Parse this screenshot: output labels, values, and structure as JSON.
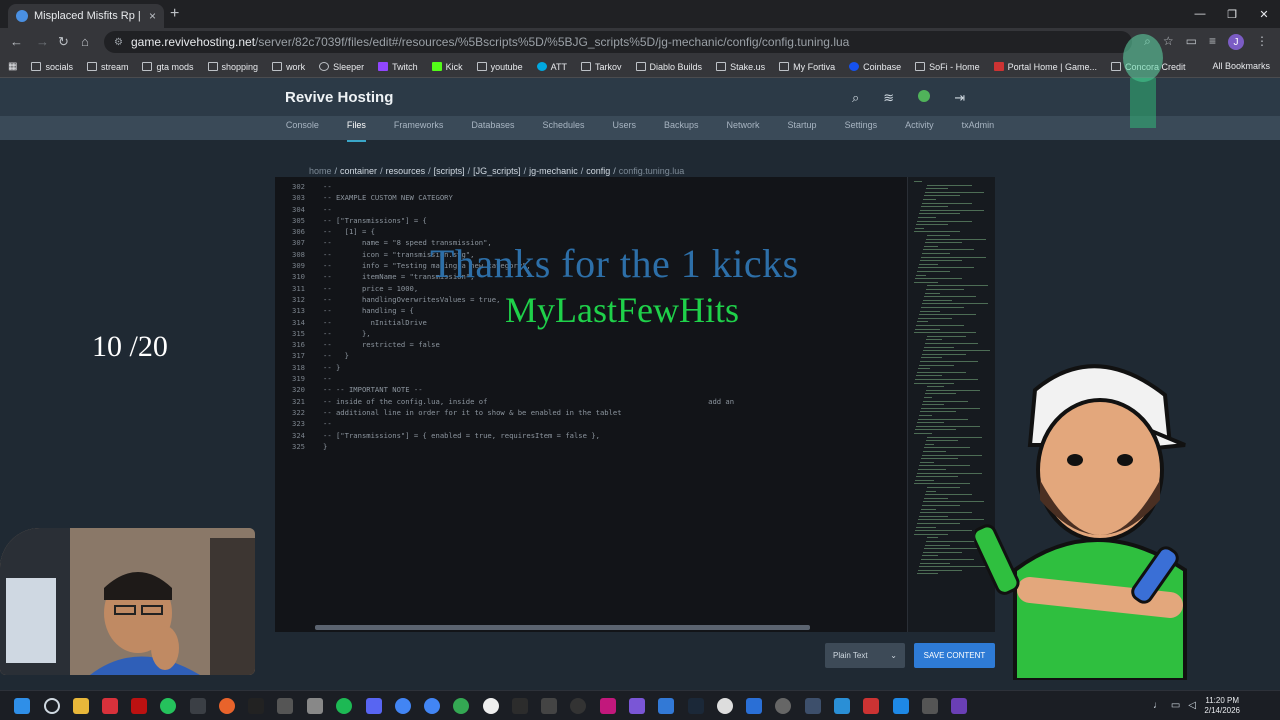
{
  "browser": {
    "tab_title": "Misplaced Misfits Rp | File Man",
    "close_tab": "×",
    "new_tab": "+",
    "url_domain": "game.revivehosting.net",
    "url_path": "/server/82c7039f/files/edit#/resources/%5Bscripts%5D/%5BJG_scripts%5D/jg-mechanic/config/config.tuning.lua",
    "profile_initial": "J",
    "bookmarks": [
      "socials",
      "stream",
      "gta mods",
      "shopping",
      "work",
      "Sleeper",
      "Twitch",
      "Kick",
      "youtube",
      "ATT",
      "Tarkov",
      "Diablo Builds",
      "Stake.us",
      "My Fortiva",
      "Coinbase",
      "SoFi - Home",
      "Portal Home | Game...",
      "Concora Credit"
    ],
    "all_bookmarks": "All Bookmarks"
  },
  "app": {
    "brand": "Revive Hosting",
    "nav": [
      "Console",
      "Files",
      "Frameworks",
      "Databases",
      "Schedules",
      "Users",
      "Backups",
      "Network",
      "Startup",
      "Settings",
      "Activity",
      "txAdmin"
    ],
    "active_nav": "Files",
    "breadcrumb": [
      "home",
      "container",
      "resources",
      "[scripts]",
      "[JG_scripts]",
      "jg-mechanic",
      "config"
    ],
    "breadcrumb_current": "config.tuning.lua",
    "syntax_mode": "Plain Text",
    "save_button": "SAVE CONTENT"
  },
  "editor": {
    "lines": [
      {
        "no": "302",
        "text": "--"
      },
      {
        "no": "303",
        "text": "-- EXAMPLE CUSTOM NEW CATEGORY"
      },
      {
        "no": "304",
        "text": "--"
      },
      {
        "no": "305",
        "text": "-- [\"Transmissions\"] = {"
      },
      {
        "no": "306",
        "text": "--   [1] = {"
      },
      {
        "no": "307",
        "text": "--       name = \"8 speed transmission\","
      },
      {
        "no": "308",
        "text": "--       icon = \"transmission.svg\","
      },
      {
        "no": "309",
        "text": "--       info = \"Testing making a new category\","
      },
      {
        "no": "310",
        "text": "--       itemName = \"transmission\","
      },
      {
        "no": "311",
        "text": "--       price = 1000,"
      },
      {
        "no": "312",
        "text": "--       handlingOverwritesValues = true,"
      },
      {
        "no": "313",
        "text": "--       handling = {"
      },
      {
        "no": "314",
        "text": "--         nInitialDrive"
      },
      {
        "no": "315",
        "text": "--       },"
      },
      {
        "no": "316",
        "text": "--       restricted = false"
      },
      {
        "no": "317",
        "text": "--   }"
      },
      {
        "no": "318",
        "text": "-- }"
      },
      {
        "no": "319",
        "text": "--"
      },
      {
        "no": "320",
        "text": "-- -- IMPORTANT NOTE --"
      },
      {
        "no": "321",
        "text": "-- inside of the config.lua, inside of                                                   add an"
      },
      {
        "no": "322",
        "text": "-- additional line in order for it to show & be enabled in the tablet"
      },
      {
        "no": "323",
        "text": "--"
      },
      {
        "no": "324",
        "text": "-- [\"Transmissions\"] = { enabled = true, requiresItem = false },"
      },
      {
        "no": "325",
        "text": "}"
      }
    ]
  },
  "stream_overlay": {
    "kicks_message": "Thanks for the 1 kicks",
    "username": "MyLastFewHits",
    "counter": "10 /20"
  },
  "taskbar": {
    "time": "11:20 PM",
    "date": "2/14/2026"
  },
  "colors": {
    "accent": "#3aa6c8",
    "save_button": "#2e7bd6",
    "kicks_text": "#2d6fa8",
    "username_text": "#1fd14a"
  }
}
